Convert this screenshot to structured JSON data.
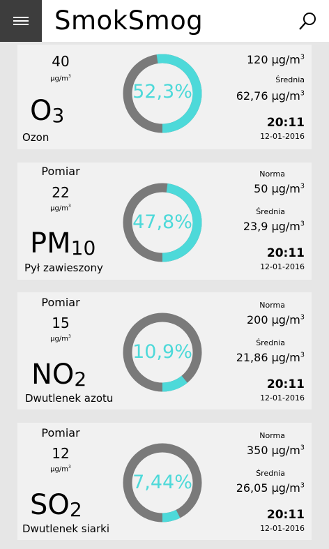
{
  "app": {
    "title": "SmokSmog"
  },
  "colors": {
    "accent": "#4dd9d9",
    "ring_base": "#7a7a7a",
    "card_bg": "#f1f1f1"
  },
  "cards": [
    {
      "measure_label": "",
      "value": "40",
      "unit_small": "μg/m",
      "unit_exp": "3",
      "formula": "O",
      "formula_sub": "3",
      "name": "Ozon",
      "percent_label": "52,3%",
      "percent": 0.523,
      "norma_label": "",
      "norma_value": "120 μg/m",
      "norma_exp": "3",
      "srednia_label": "Średnia",
      "srednia_value": "62,76 μg/m",
      "srednia_exp": "3",
      "time": "20:11",
      "date": "12-01-2016"
    },
    {
      "measure_label": "Pomiar",
      "value": "22",
      "unit_small": "μg/m",
      "unit_exp": "3",
      "formula": "PM",
      "formula_sub": "10",
      "name": "Pył zawieszony",
      "percent_label": "47,8%",
      "percent": 0.478,
      "norma_label": "Norma",
      "norma_value": "50 μg/m",
      "norma_exp": "3",
      "srednia_label": "Średnia",
      "srednia_value": "23,9 μg/m",
      "srednia_exp": "3",
      "time": "20:11",
      "date": "12-01-2016"
    },
    {
      "measure_label": "Pomiar",
      "value": "15",
      "unit_small": "μg/m",
      "unit_exp": "3",
      "formula": "NO",
      "formula_sub": "2",
      "name": "Dwutlenek azotu",
      "percent_label": "10,9%",
      "percent": 0.109,
      "norma_label": "Norma",
      "norma_value": "200 μg/m",
      "norma_exp": "3",
      "srednia_label": "Średnia",
      "srednia_value": "21,86 μg/m",
      "srednia_exp": "3",
      "time": "20:11",
      "date": "12-01-2016"
    },
    {
      "measure_label": "Pomiar",
      "value": "12",
      "unit_small": "μg/m",
      "unit_exp": "3",
      "formula": "SO",
      "formula_sub": "2",
      "name": "Dwutlenek siarki",
      "percent_label": "7,44%",
      "percent": 0.0744,
      "norma_label": "Norma",
      "norma_value": "350 μg/m",
      "norma_exp": "3",
      "srednia_label": "Średnia",
      "srednia_value": "26,05 μg/m",
      "srednia_exp": "3",
      "time": "20:11",
      "date": "12-01-2016"
    }
  ]
}
